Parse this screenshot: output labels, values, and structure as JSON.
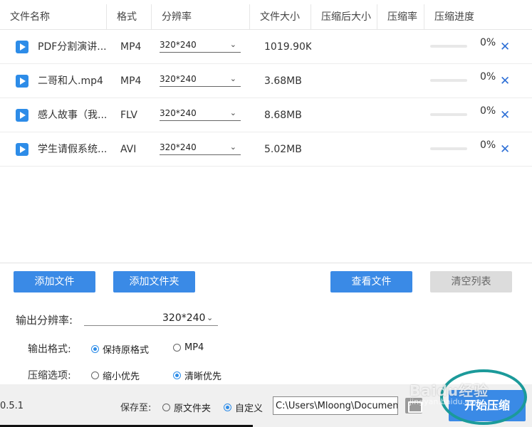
{
  "table": {
    "columns": [
      "文件名称",
      "格式",
      "分辨率",
      "文件大小",
      "压缩后大小",
      "压缩率",
      "压缩进度"
    ],
    "rows": [
      {
        "name": "PDF分割演讲...",
        "format": "MP4",
        "resolution": "320*240",
        "size": "1019.90KB",
        "compressed_size": "",
        "ratio": "",
        "progress_label": "0%",
        "progress": 0
      },
      {
        "name": "二哥和人.mp4",
        "format": "MP4",
        "resolution": "320*240",
        "size": "3.68MB",
        "compressed_size": "",
        "ratio": "",
        "progress_label": "0%",
        "progress": 0
      },
      {
        "name": "感人故事（我...",
        "format": "FLV",
        "resolution": "320*240",
        "size": "8.68MB",
        "compressed_size": "",
        "ratio": "",
        "progress_label": "0%",
        "progress": 0
      },
      {
        "name": "学生请假系统...",
        "format": "AVI",
        "resolution": "320*240",
        "size": "5.02MB",
        "compressed_size": "",
        "ratio": "",
        "progress_label": "0%",
        "progress": 0
      }
    ]
  },
  "buttons": {
    "add_file": "添加文件",
    "add_folder": "添加文件夹",
    "view_file": "查看文件",
    "clear_list": "清空列表"
  },
  "settings": {
    "output_resolution_label": "输出分辨率:",
    "output_resolution_value": "320*240",
    "output_format_label": "输出格式:",
    "format_options": [
      {
        "label": "保持原格式",
        "selected": true
      },
      {
        "label": "MP4",
        "selected": false
      }
    ],
    "compress_option_label": "压缩选项:",
    "compress_options": [
      {
        "label": "缩小优先",
        "selected": false
      },
      {
        "label": "清晰优先",
        "selected": true
      }
    ]
  },
  "footer": {
    "version": "0.5.1",
    "save_to_label": "保存至:",
    "save_options": [
      {
        "label": "原文件夹",
        "selected": false
      },
      {
        "label": "自定义",
        "selected": true
      }
    ],
    "save_path": "C:\\Users\\Mloong\\Documents",
    "start_button": "开始压缩"
  },
  "overlay": {
    "watermark": "Baidu经验",
    "watermark_sub": "jingyan.baidu.com"
  },
  "colors": {
    "accent": "#3a8ae6",
    "highlight": "#1b9a9a",
    "remove": "#2d6fd6"
  }
}
